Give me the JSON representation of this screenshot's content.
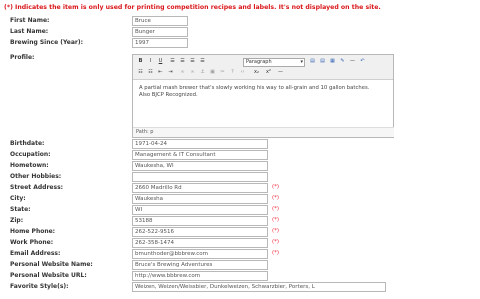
{
  "notice": "(*) Indicates the item is only used for printing competition recipes and labels. It's not displayed on the site.",
  "required_mark": "(*)",
  "editor": {
    "format_value": "Paragraph",
    "content": "A partial mash brewer that's slowly working his way to all-grain and 10 gallon batches. Also BJCP Recognized.",
    "path": "Path: p"
  },
  "fields": [
    {
      "label": "First Name:",
      "value": "Bruce"
    },
    {
      "label": "Last Name:",
      "value": "Bunger"
    },
    {
      "label": "Brewing Since (Year):",
      "value": "1997"
    },
    {
      "label": "Profile:",
      "value": ""
    },
    {
      "label": "Birthdate:",
      "value": "1971-04-24"
    },
    {
      "label": "Occupation:",
      "value": "Management & IT Consultant"
    },
    {
      "label": "Hometown:",
      "value": "Waukesha, WI"
    },
    {
      "label": "Other Hobbies:",
      "value": ""
    },
    {
      "label": "Street Address:",
      "value": "2660 Madrillo Rd"
    },
    {
      "label": "City:",
      "value": "Waukesha"
    },
    {
      "label": "State:",
      "value": "WI"
    },
    {
      "label": "Zip:",
      "value": "53188"
    },
    {
      "label": "Home Phone:",
      "value": "262-522-9516"
    },
    {
      "label": "Work Phone:",
      "value": "262-358-1474"
    },
    {
      "label": "Email Address:",
      "value": "bmunthoder@bbbrew.com"
    },
    {
      "label": "Personal Website Name:",
      "value": "Bruce's Brewing Adventures"
    },
    {
      "label": "Personal Website URL:",
      "value": "http://www.bbbrew.com"
    },
    {
      "label": "Favorite Style(s):",
      "value": "Weizen, Weizen/Weissbier, Dunkelweizen, Schwarzbier, Porters, L"
    }
  ],
  "icons": [
    "bold-icon",
    "italic-icon",
    "underline-icon",
    "align-left-icon",
    "align-center-icon",
    "align-right-icon",
    "justify-icon",
    "paste-icon",
    "paste-text-icon",
    "paste-word-icon",
    "clean-icon",
    "hr-icon",
    "undo-icon",
    "bullet-list-icon",
    "numbered-list-icon",
    "outdent-icon",
    "indent-icon",
    "link-icon",
    "unlink-icon",
    "redo-icon"
  ]
}
